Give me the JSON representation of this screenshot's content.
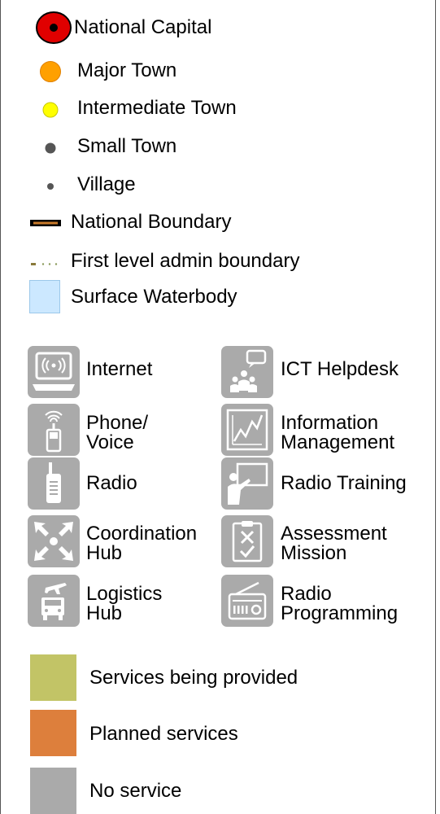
{
  "legend": {
    "places": [
      {
        "label": "National Capital",
        "icon": "national-capital-icon",
        "color": "#e00000"
      },
      {
        "label": "Major Town",
        "icon": "major-town-icon",
        "color": "#ffa000"
      },
      {
        "label": "Intermediate Town",
        "icon": "intermediate-town-icon",
        "color": "#ffff00"
      },
      {
        "label": "Small Town",
        "icon": "small-town-icon",
        "color": "#555555"
      },
      {
        "label": "Village",
        "icon": "village-icon",
        "color": "#555555"
      }
    ],
    "lines": [
      {
        "label": "National Boundary",
        "icon": "national-boundary-icon"
      },
      {
        "label": "First level admin boundary",
        "icon": "admin-boundary-icon"
      },
      {
        "label": "Surface Waterbody",
        "icon": "waterbody-icon",
        "color": "#cce8ff"
      }
    ],
    "services": [
      {
        "label": "Internet",
        "icon": "internet-icon"
      },
      {
        "label": "ICT Helpdesk",
        "icon": "helpdesk-icon"
      },
      {
        "label": "Phone/\nVoice",
        "icon": "phone-icon"
      },
      {
        "label": "Information\nManagement",
        "icon": "information-management-icon"
      },
      {
        "label": "Radio",
        "icon": "radio-icon"
      },
      {
        "label": "Radio Training",
        "icon": "radio-training-icon"
      },
      {
        "label": "Coordination\nHub",
        "icon": "coordination-hub-icon"
      },
      {
        "label": "Assessment\nMission",
        "icon": "assessment-icon"
      },
      {
        "label": "Logistics\nHub",
        "icon": "logistics-icon"
      },
      {
        "label": "Radio\nProgramming",
        "icon": "radio-programming-icon"
      }
    ],
    "status": [
      {
        "label": "Services being provided",
        "color": "#c2c466"
      },
      {
        "label": "Planned services",
        "color": "#dd7f3c"
      },
      {
        "label": "No service",
        "color": "#aaaaaa"
      }
    ]
  }
}
